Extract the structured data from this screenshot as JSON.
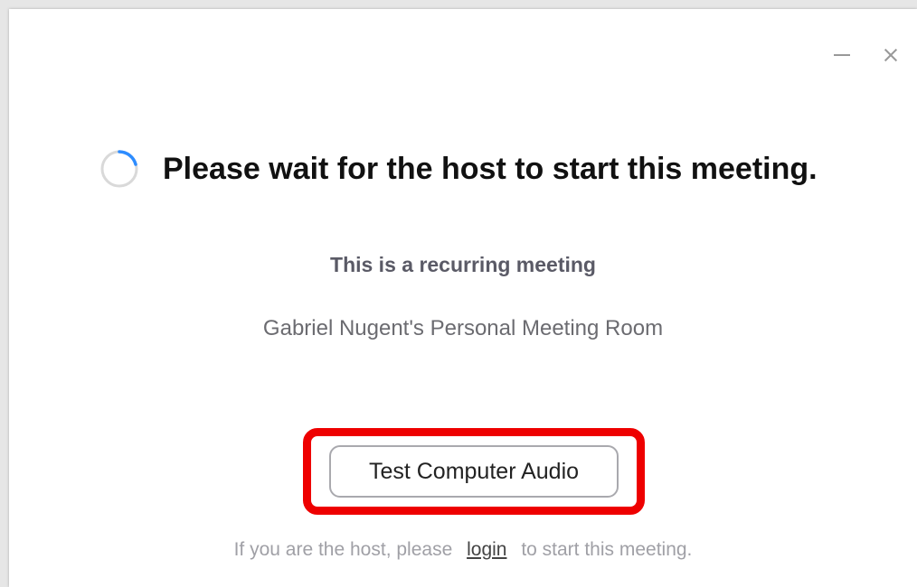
{
  "window": {
    "controls": {
      "minimize_icon": "minimize-icon",
      "close_icon": "close-icon"
    }
  },
  "main": {
    "title": "Please wait for the host to start this meeting.",
    "subtitle": "This is a recurring meeting",
    "room_name": "Gabriel Nugent's Personal Meeting Room",
    "test_audio_label": "Test Computer Audio"
  },
  "footer": {
    "prefix": "If you are the host, please",
    "login_label": "login",
    "suffix": "to start this meeting."
  },
  "colors": {
    "highlight": "#ee0000",
    "spinner_accent": "#2d8cff",
    "spinner_track": "#d9d9d9"
  }
}
